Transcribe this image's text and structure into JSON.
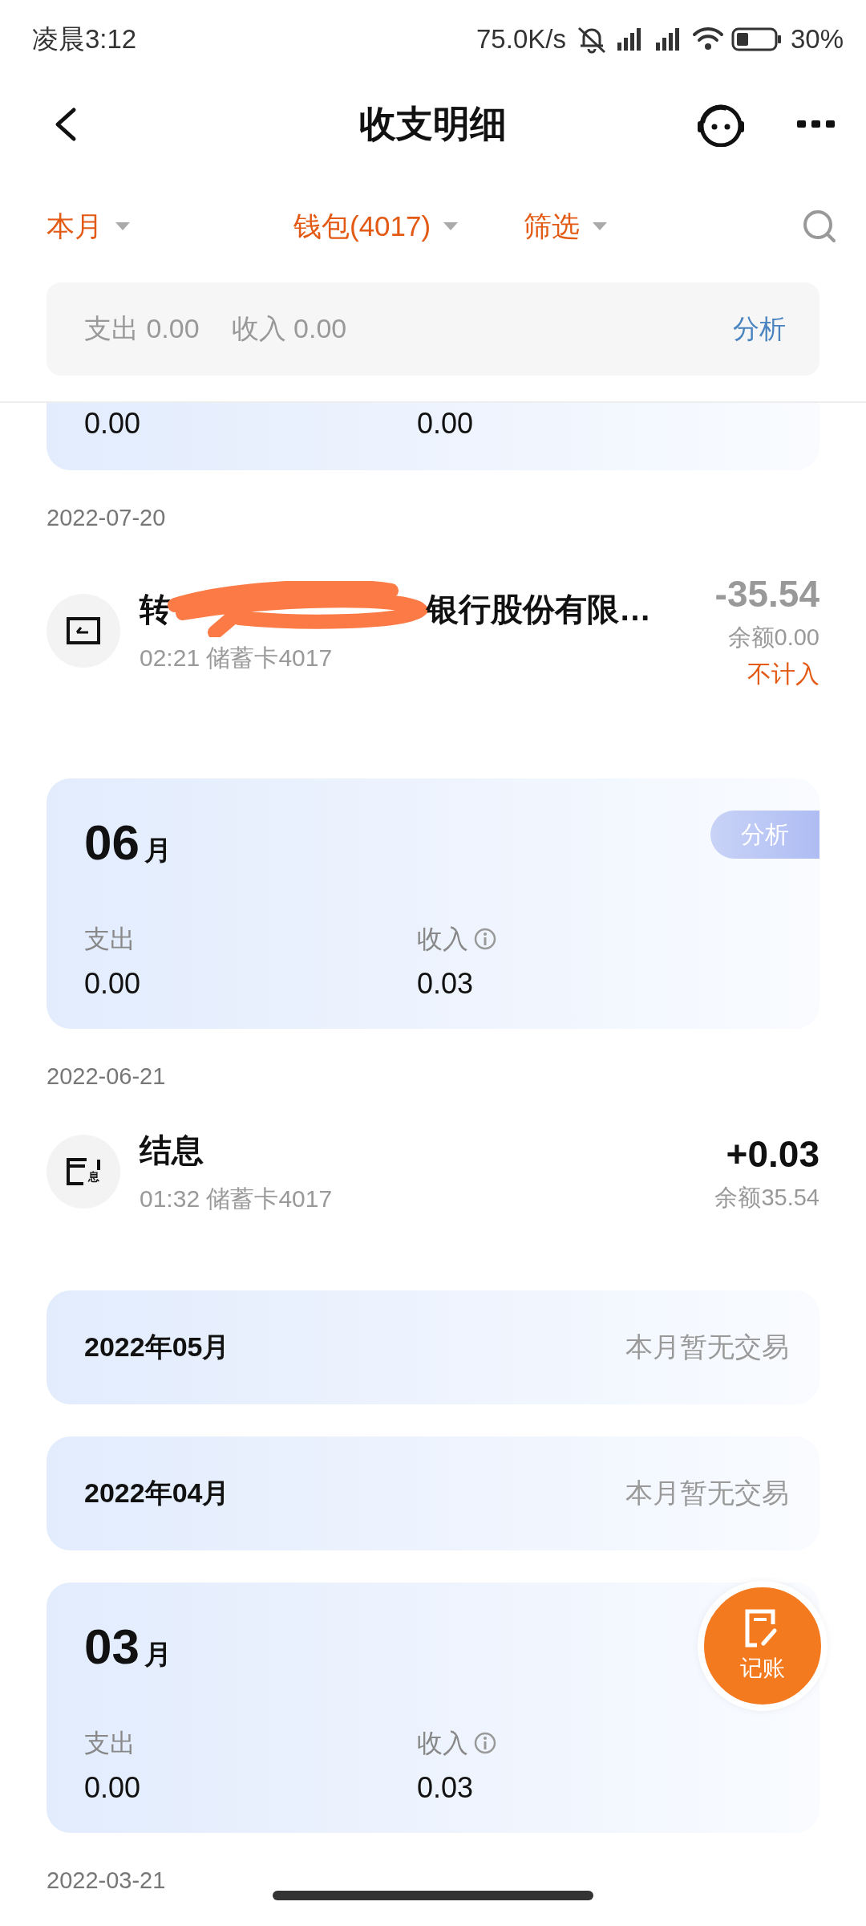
{
  "status_bar": {
    "time": "凌晨3:12",
    "net_speed": "75.0K/s",
    "battery": "30%"
  },
  "nav": {
    "title": "收支明细"
  },
  "filters": [
    {
      "label": "本月",
      "kind": "dropdown"
    },
    {
      "label": "钱包(4017)",
      "kind": "dropdown"
    },
    {
      "label": "筛选",
      "kind": "dropdown"
    },
    {
      "kind": "search"
    }
  ],
  "summary": {
    "expense": "支出 0.00",
    "income": "收入 0.00",
    "action": "分析"
  },
  "sections": [
    {
      "kind": "month_partial",
      "expense_value": "0.00",
      "income_value": "0.00"
    },
    {
      "kind": "date",
      "text": "2022-07-20"
    },
    {
      "kind": "transaction",
      "title_parts": [
        "转",
        "银行股份有限…"
      ],
      "redacted": true,
      "subtitle": "02:21 储蓄卡4017",
      "amount": "-35.54",
      "muted": true,
      "balance": "余额0.00",
      "note": "不计入"
    },
    {
      "kind": "month",
      "month": "06",
      "unit": "月",
      "expense_label": "支出",
      "expense_value": "0.00",
      "income_label": "收入",
      "income_value": "0.03",
      "action": "分析"
    },
    {
      "kind": "date",
      "text": "2022-06-21"
    },
    {
      "kind": "transaction",
      "icon_text": "息",
      "title_parts": [
        "结息"
      ],
      "redacted": false,
      "subtitle": "01:32 储蓄卡4017",
      "amount": "+0.03",
      "muted": false,
      "balance": "余额35.54"
    },
    {
      "kind": "month_empty",
      "title": "2022年05月",
      "note": "本月暂无交易"
    },
    {
      "kind": "month_empty",
      "title": "2022年04月",
      "note": "本月暂无交易"
    },
    {
      "kind": "month",
      "month": "03",
      "unit": "月",
      "expense_label": "支出",
      "expense_value": "0.00",
      "income_label": "收入",
      "income_value": "0.03"
    },
    {
      "kind": "date",
      "text": "2022-03-21"
    }
  ],
  "fab": {
    "label": "记账"
  }
}
